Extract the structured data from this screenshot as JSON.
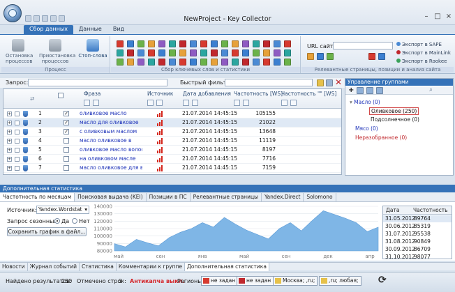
{
  "window": {
    "title": "NewProject - Key Collector"
  },
  "ribbon": {
    "tabs": [
      {
        "label": "Сбор данных",
        "active": true
      },
      {
        "label": "Данные",
        "active": false
      },
      {
        "label": "Вид",
        "active": false
      }
    ],
    "process": {
      "stop_label": "Остановка процессов",
      "pause_label": "Приостановка процессов",
      "stopwords_label": "Стоп-слова",
      "group_label": "Процесс"
    },
    "collect_group_label": "Сбор ключевых слов и статистики",
    "url_label": "URL сайта:",
    "url_value": "",
    "exports": [
      "Экспорт в SAPE",
      "Экспорт в MainLink",
      "Экспорт в Rookee"
    ],
    "relevant_group_label": "Релевантные страницы, позиции и анализ сайта"
  },
  "querybar": {
    "query_label": "Запрос:",
    "query_value": "",
    "filter_label": "Быстрый фильтр:",
    "filter_value": ""
  },
  "grid": {
    "headers": {
      "phrase": "Фраза",
      "source": "Источник",
      "date": "Дата добавления",
      "freq": "Частотность [WS]",
      "freq2": "Частотность \"\" [WS]"
    },
    "rows": [
      {
        "num": "1",
        "checked": true,
        "phrase": "оливковое масло",
        "date": "21.07.2014 14:45:15",
        "freq": "105155",
        "selected": false
      },
      {
        "num": "2",
        "checked": true,
        "phrase": "масло для оливковое",
        "date": "21.07.2014 14:45:15",
        "freq": "21022",
        "selected": true
      },
      {
        "num": "3",
        "checked": true,
        "phrase": "с оливковым маслом",
        "date": "21.07.2014 14:45:15",
        "freq": "13648",
        "selected": false
      },
      {
        "num": "4",
        "checked": false,
        "phrase": "масло оливковое в",
        "date": "21.07.2014 14:45:15",
        "freq": "11119",
        "selected": false
      },
      {
        "num": "5",
        "checked": false,
        "phrase": "оливковое масло волосы",
        "date": "21.07.2014 14:45:15",
        "freq": "8197",
        "selected": false
      },
      {
        "num": "6",
        "checked": false,
        "phrase": "на оливковом масле",
        "date": "21.07.2014 14:45:15",
        "freq": "7716",
        "selected": false
      },
      {
        "num": "7",
        "checked": false,
        "phrase": "масло оливковое для волос",
        "date": "21.07.2014 14:45:15",
        "freq": "7159",
        "selected": false
      }
    ]
  },
  "groups": {
    "title": "Управление группами",
    "nodes": [
      {
        "label": "Масло (0)",
        "level": 0,
        "color": "#1b30b8"
      },
      {
        "label": "Оливковое (250)",
        "level": 1,
        "color": "#1a1a1a",
        "selected": true
      },
      {
        "label": "Подсолнечное (0)",
        "level": 1,
        "color": "#1a1a1a"
      },
      {
        "label": "Мясо (0)",
        "level": 0,
        "color": "#1b30b8"
      },
      {
        "label": "Неразобранное (0)",
        "level": 0,
        "color": "#c0282d"
      }
    ]
  },
  "stats": {
    "title": "Дополнительная статистика",
    "tabs": [
      "Частотность по месяцам",
      "Поисковая выдача (KEI)",
      "Позиции в ПС",
      "Релевантные страницы",
      "Yandex.Direct",
      "Solomono"
    ],
    "source_label": "Источник:",
    "source_value": "Yandex.Wordstat",
    "seasonal_label": "Запрос сезонный:",
    "yes_label": "Да",
    "no_label": "Нет",
    "save_chart_label": "Сохранить график в файл...",
    "table_headers": {
      "date": "Дата",
      "freq": "Частотность"
    },
    "table_rows": [
      {
        "date": "31.05.2012",
        "freq": "89764"
      },
      {
        "date": "30.06.2012",
        "freq": "85319"
      },
      {
        "date": "31.07.2012",
        "freq": "95538"
      },
      {
        "date": "31.08.2012",
        "freq": "90849"
      },
      {
        "date": "30.09.2012",
        "freq": "86709"
      },
      {
        "date": "31.10.2012",
        "freq": "98077"
      }
    ]
  },
  "chart_data": {
    "type": "area",
    "categories": [
      "май",
      "июн",
      "июл",
      "авг",
      "сен",
      "окт",
      "ноя",
      "дек",
      "янв",
      "фев",
      "мар",
      "апр",
      "май",
      "июн",
      "июл",
      "авг",
      "сен",
      "окт",
      "ноя",
      "дек",
      "янв",
      "фев",
      "мар",
      "апр",
      "май"
    ],
    "tick_labels": [
      "май",
      "сен",
      "янв",
      "май",
      "сен",
      "дек",
      "апр"
    ],
    "values": [
      89764,
      85319,
      95538,
      90849,
      86709,
      98077,
      105000,
      110000,
      118000,
      112000,
      125000,
      116000,
      108000,
      102000,
      96000,
      110000,
      118000,
      107000,
      121000,
      134000,
      129000,
      124000,
      118000,
      106000,
      112000
    ],
    "ylim": [
      80000,
      140000
    ],
    "yticks": [
      "140000",
      "130000",
      "120000",
      "110000",
      "100000",
      "90000",
      "80000"
    ],
    "grid": true,
    "color": "#7fb6e6"
  },
  "bottom_tabs": [
    "Новости",
    "Журнал событий",
    "Статистика",
    "Комментарии к группе",
    "Дополнительная статистика"
  ],
  "status": {
    "found_label": "Найдено результатов:",
    "found_value": "250",
    "marked_label": "Отмечено строк:",
    "marked_value": "3",
    "anticaptcha": "Антикапча выкл.",
    "regions_label": "Регионы:",
    "regions": [
      "не задан",
      "не задан",
      "Москва; ,ru;",
      ",ru; любая;"
    ]
  }
}
